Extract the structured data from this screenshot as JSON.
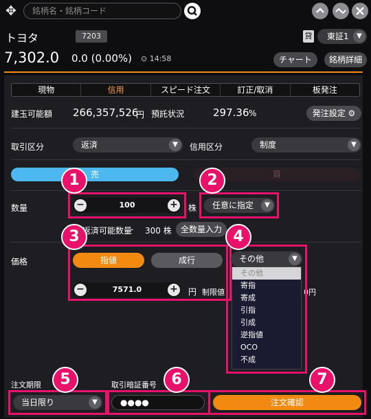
{
  "search": {
    "placeholder": "銘柄名・銘柄コード"
  },
  "header": {
    "stock_name": "トヨタ",
    "code": "7203",
    "kashi": "貸",
    "exchange": "東証1",
    "price": "7,302.0",
    "change": "0.0 (0.00%)",
    "time": "14:58",
    "chart_button": "チャート",
    "detail_button": "銘柄詳細"
  },
  "tabs": [
    "現物",
    "信用",
    "スピード注文",
    "訂正/取消",
    "板発注"
  ],
  "account": {
    "buying_power_label": "建玉可能額",
    "buying_power_value": "266,357,526",
    "buying_power_unit": "円",
    "margin_label": "預託状況",
    "margin_value": "297.36",
    "margin_unit": "%",
    "order_settings_button": "発注設定"
  },
  "trade": {
    "trade_type_label": "取引区分",
    "trade_type_value": "返済",
    "credit_type_label": "信用区分",
    "credit_type_value": "制度",
    "sell_label": "売",
    "buy_label": "買"
  },
  "quantity": {
    "label": "数量",
    "value": "100",
    "unit": "株",
    "mode": "任意に指定",
    "possible_label": "返済可能数量",
    "possible_dash": "-",
    "possible_value": "300 株",
    "all_button": "全数量入力"
  },
  "price_section": {
    "label": "価格",
    "limit_button": "指値",
    "market_button": "成行",
    "other_select": "その他",
    "price_value": "7571.0",
    "price_unit": "円",
    "limit_range_label": "制限値",
    "right_suffix": "0円",
    "options": [
      "その他",
      "寄指",
      "寄成",
      "引指",
      "引成",
      "逆指値",
      "OCO",
      "不成"
    ]
  },
  "footer": {
    "expiry_label": "注文期限",
    "expiry_value": "当日限り",
    "pin_label": "取引暗証番号",
    "pin_value": "●●●●",
    "confirm_button": "注文確認"
  },
  "markers": [
    "1",
    "2",
    "3",
    "4",
    "5",
    "6",
    "7"
  ],
  "colors": {
    "accent": "#f28a12",
    "highlight": "#e8126a",
    "sell": "#4db8f0"
  }
}
